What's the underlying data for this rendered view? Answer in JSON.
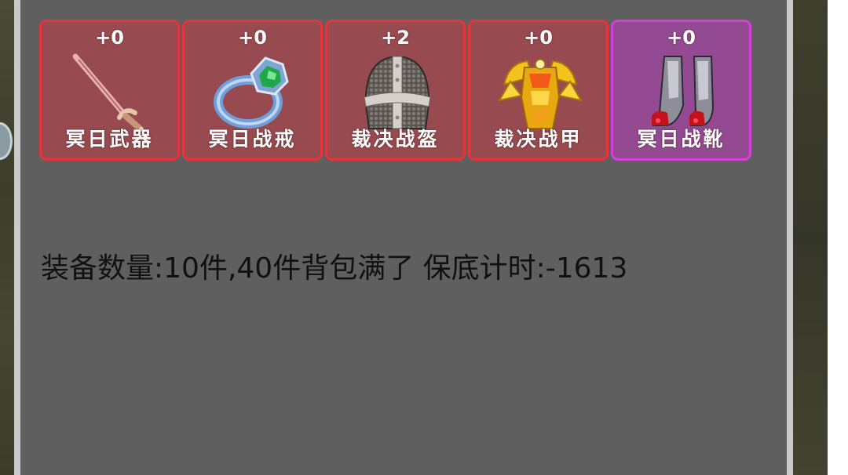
{
  "equipment_slots": [
    {
      "level": "+0",
      "name": "冥日武器",
      "icon": "sword-icon",
      "rarity": "red"
    },
    {
      "level": "+0",
      "name": "冥日战戒",
      "icon": "ring-icon",
      "rarity": "red"
    },
    {
      "level": "+2",
      "name": "裁决战盔",
      "icon": "helmet-icon",
      "rarity": "red"
    },
    {
      "level": "+0",
      "name": "裁决战甲",
      "icon": "armor-icon",
      "rarity": "red"
    },
    {
      "level": "+0",
      "name": "冥日战靴",
      "icon": "boots-icon",
      "rarity": "purple"
    }
  ],
  "status": {
    "info_line": "装备数量:10件,40件背包满了 保底计时:-1613"
  },
  "colors": {
    "panel_bg": "#5f5f5f",
    "red_border": "#e8323c",
    "red_fill": "#974a50",
    "purple_border": "#d63fd8",
    "purple_fill": "#934a93"
  }
}
